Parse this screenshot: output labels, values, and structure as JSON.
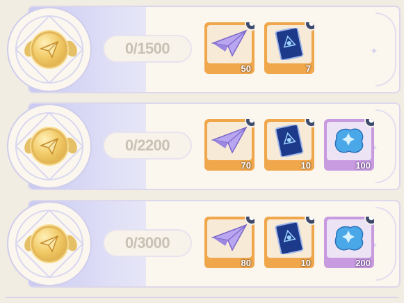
{
  "tiers": [
    {
      "progress": "0/1500",
      "rewards": [
        {
          "icon": "paper-plane-icon",
          "qty": "50",
          "rarity": "orange"
        },
        {
          "icon": "tarot-card-icon",
          "qty": "7",
          "rarity": "orange"
        }
      ]
    },
    {
      "progress": "0/2200",
      "rewards": [
        {
          "icon": "paper-plane-icon",
          "qty": "70",
          "rarity": "orange"
        },
        {
          "icon": "tarot-card-icon",
          "qty": "10",
          "rarity": "orange"
        },
        {
          "icon": "blue-crystal-icon",
          "qty": "100",
          "rarity": "purple"
        }
      ]
    },
    {
      "progress": "0/3000",
      "rewards": [
        {
          "icon": "paper-plane-icon",
          "qty": "80",
          "rarity": "orange"
        },
        {
          "icon": "tarot-card-icon",
          "qty": "10",
          "rarity": "orange"
        },
        {
          "icon": "blue-crystal-icon",
          "qty": "200",
          "rarity": "purple"
        }
      ]
    }
  ],
  "colors": {
    "orange": "#f0a64a",
    "purple": "#c89be0",
    "panel": "#fbf7ee",
    "accent": "#c9c9f2"
  }
}
